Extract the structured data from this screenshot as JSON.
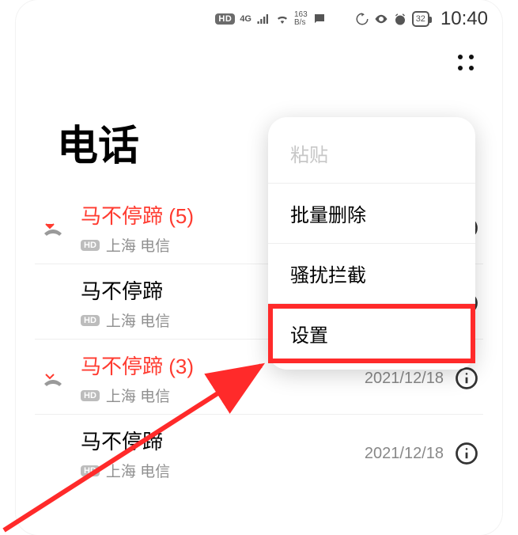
{
  "statusbar": {
    "hd": "HD",
    "netlabel": "4G",
    "rate_top": "163",
    "rate_bot": "B/s",
    "battery": "32",
    "time": "10:40"
  },
  "title": "电话",
  "calls": [
    {
      "name": "马不停蹄 (5)",
      "missed": true,
      "hd": "HD",
      "sub": "上海 电信",
      "date": ""
    },
    {
      "name": "马不停蹄",
      "missed": false,
      "hd": "HD",
      "sub": "上海 电信",
      "date": ""
    },
    {
      "name": "马不停蹄 (3)",
      "missed": true,
      "hd": "HD",
      "sub": "上海 电信",
      "date": "2021/12/18"
    },
    {
      "name": "马不停蹄",
      "missed": false,
      "hd": "HD",
      "sub": "上海 电信",
      "date": "2021/12/18"
    }
  ],
  "menu": {
    "paste": "粘贴",
    "batch_delete": "批量删除",
    "block": "骚扰拦截",
    "settings": "设置"
  }
}
